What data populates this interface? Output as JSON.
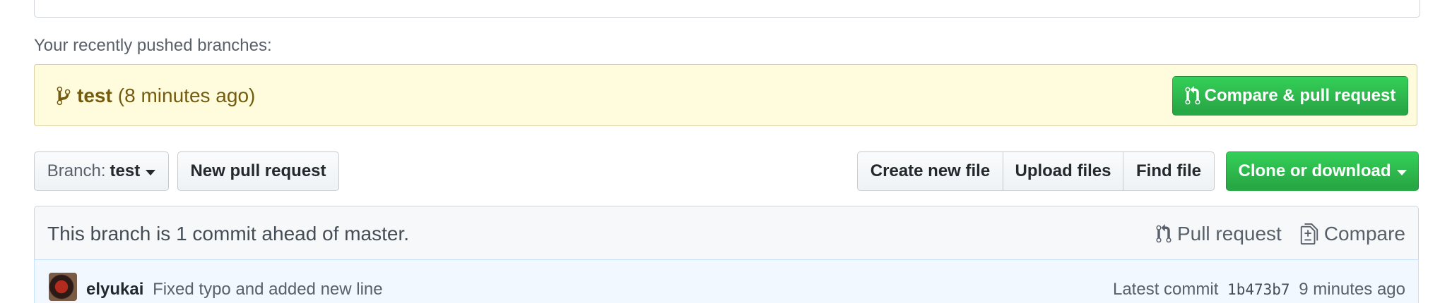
{
  "recent": {
    "label": "Your recently pushed branches:",
    "branch_name": "test",
    "branch_time": "(8 minutes ago)",
    "compare_button": "Compare & pull request"
  },
  "toolbar": {
    "branch_prefix": "Branch:",
    "branch_name": "test",
    "new_pull_request": "New pull request",
    "create_new_file": "Create new file",
    "upload_files": "Upload files",
    "find_file": "Find file",
    "clone_or_download": "Clone or download"
  },
  "branch_info": {
    "status": "This branch is 1 commit ahead of master.",
    "pull_request": "Pull request",
    "compare": "Compare"
  },
  "commit": {
    "author": "elyukai",
    "message": "Fixed typo and added new line",
    "latest_label": "Latest commit",
    "sha": "1b473b7",
    "time": "9 minutes ago"
  },
  "colors": {
    "green": "#28a745",
    "recent_bg": "#fffbdd",
    "recent_text": "#735c0f"
  }
}
